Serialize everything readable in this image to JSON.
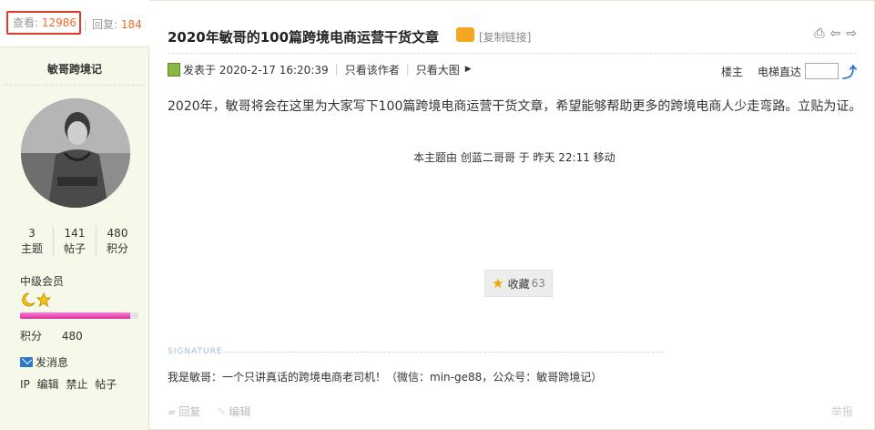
{
  "thread": {
    "views_label": "查看:",
    "views": "12986",
    "replies_label": "回复:",
    "replies": "184",
    "title": "2020年敏哥的100篇跨境电商运营干货文章",
    "copy_link": "[复制链接]"
  },
  "author": {
    "name": "敏哥跨境记",
    "stats": [
      {
        "value": "3",
        "label": "主题"
      },
      {
        "value": "141",
        "label": "帖子"
      },
      {
        "value": "480",
        "label": "积分"
      }
    ],
    "rank": "中级会员",
    "level_progress": 0.93,
    "points_label": "积分",
    "points_value": "480",
    "send_message": "发消息",
    "admin_links": [
      "IP",
      "编辑",
      "禁止",
      "帖子"
    ]
  },
  "post": {
    "posted_at": "发表于 2020-2-17 16:20:39",
    "only_author": "只看该作者",
    "view_large": "只看大图",
    "floor": "楼主",
    "elevator": "电梯直达",
    "content": "2020年，敏哥将会在这里为大家写下100篇跨境电商运营干货文章，希望能够帮助更多的跨境电商人少走弯路。立贴为证。",
    "moved_notice": "本主题由 创蓝二哥哥 于 昨天 22:11 移动",
    "favorite_label": "收藏",
    "favorite_count": "63",
    "signature_label": "SIGNATURE",
    "signature": "我是敏哥：一个只讲真话的跨境电商老司机！（微信：min-ge88，公众号：敏哥跨境记）",
    "reply_action": "回复",
    "edit_action": "编辑",
    "report_action": "举报"
  },
  "colors": {
    "highlight_box": "#e03a2a",
    "number_orange": "#f26c2b",
    "sidebar_bg": "#f6f8e9",
    "level_bar": "#d6379c"
  }
}
